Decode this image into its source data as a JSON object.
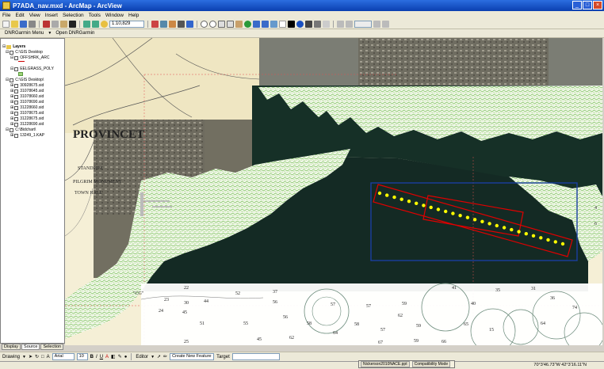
{
  "window": {
    "title": "P7ADA_nav.mxd - ArcMap - ArcView"
  },
  "menu": [
    "File",
    "Edit",
    "View",
    "Insert",
    "Selection",
    "Tools",
    "Window",
    "Help"
  ],
  "toolbar": {
    "scale": "1:10,829",
    "dnr_menu": "DNRGarmin Menu",
    "dnr_open": "Open DNRGarmin"
  },
  "toc": {
    "layers_title": "Layers",
    "groups": [
      {
        "name": "C:\\GIS Desktop",
        "items": [
          "OFFSHRK_ARC",
          "EELGRASS_POLY"
        ]
      },
      {
        "name": "C:\\GIS Desktop\\",
        "items": [
          "30928675.sid",
          "31078645.sid",
          "31078660.sid",
          "31078690.sid",
          "31228660.sid",
          "31078675.sid",
          "31228675.sid",
          "31228690.sid"
        ]
      },
      {
        "name": "C:\\Bidchart\\",
        "items": [
          "13249_1.KAP"
        ]
      }
    ],
    "tabs": [
      "Display",
      "Source",
      "Selection"
    ]
  },
  "map": {
    "chart_labels": [
      "PROVINCET",
      "STANDPIPE",
      "PILGRIM MONUMENT",
      "TOWN HALL",
      "\"CG\""
    ],
    "depths": [
      "22",
      "44",
      "52",
      "23",
      "37",
      "56",
      "57",
      "59",
      "41",
      "35",
      "24",
      "45",
      "51",
      "55",
      "56",
      "58",
      "57",
      "40",
      "62",
      "57",
      "59",
      "65",
      "58",
      "64",
      "67",
      "25",
      "30",
      "15",
      "31",
      "45",
      "36",
      "74",
      "64",
      "62",
      "66",
      "59",
      "4",
      "6"
    ]
  },
  "drawbar": {
    "drawing": "Drawing",
    "font": "Arial",
    "size": "10",
    "editor": "Editor",
    "task": "Create New Feature",
    "target": "Target"
  },
  "taskbar": {
    "item1": "Nickerson2010NACE.ppt",
    "item2": "Compatibility Mode"
  },
  "status": {
    "coords": "70°3'46.73\"W  42°3'16.11\"N"
  },
  "colors": {
    "eelgrass": "#9fd37a",
    "water_dark": "#142a24",
    "accent_blue": "#1a3fa0",
    "mark_yellow": "#ffff00",
    "box_red": "#e00000"
  },
  "survey_points": [
    {
      "t": 0.0
    },
    {
      "t": 0.04
    },
    {
      "t": 0.08
    },
    {
      "t": 0.12
    },
    {
      "t": 0.16
    },
    {
      "t": 0.2
    },
    {
      "t": 0.24
    },
    {
      "t": 0.28
    },
    {
      "t": 0.32
    },
    {
      "t": 0.36
    },
    {
      "t": 0.4
    },
    {
      "t": 0.44
    },
    {
      "t": 0.48
    },
    {
      "t": 0.52
    },
    {
      "t": 0.56
    },
    {
      "t": 0.6
    },
    {
      "t": 0.64
    },
    {
      "t": 0.68
    },
    {
      "t": 0.72
    },
    {
      "t": 0.76
    },
    {
      "t": 0.8
    },
    {
      "t": 0.84
    },
    {
      "t": 0.88
    },
    {
      "t": 0.92
    },
    {
      "t": 0.96
    },
    {
      "t": 1.0
    }
  ]
}
